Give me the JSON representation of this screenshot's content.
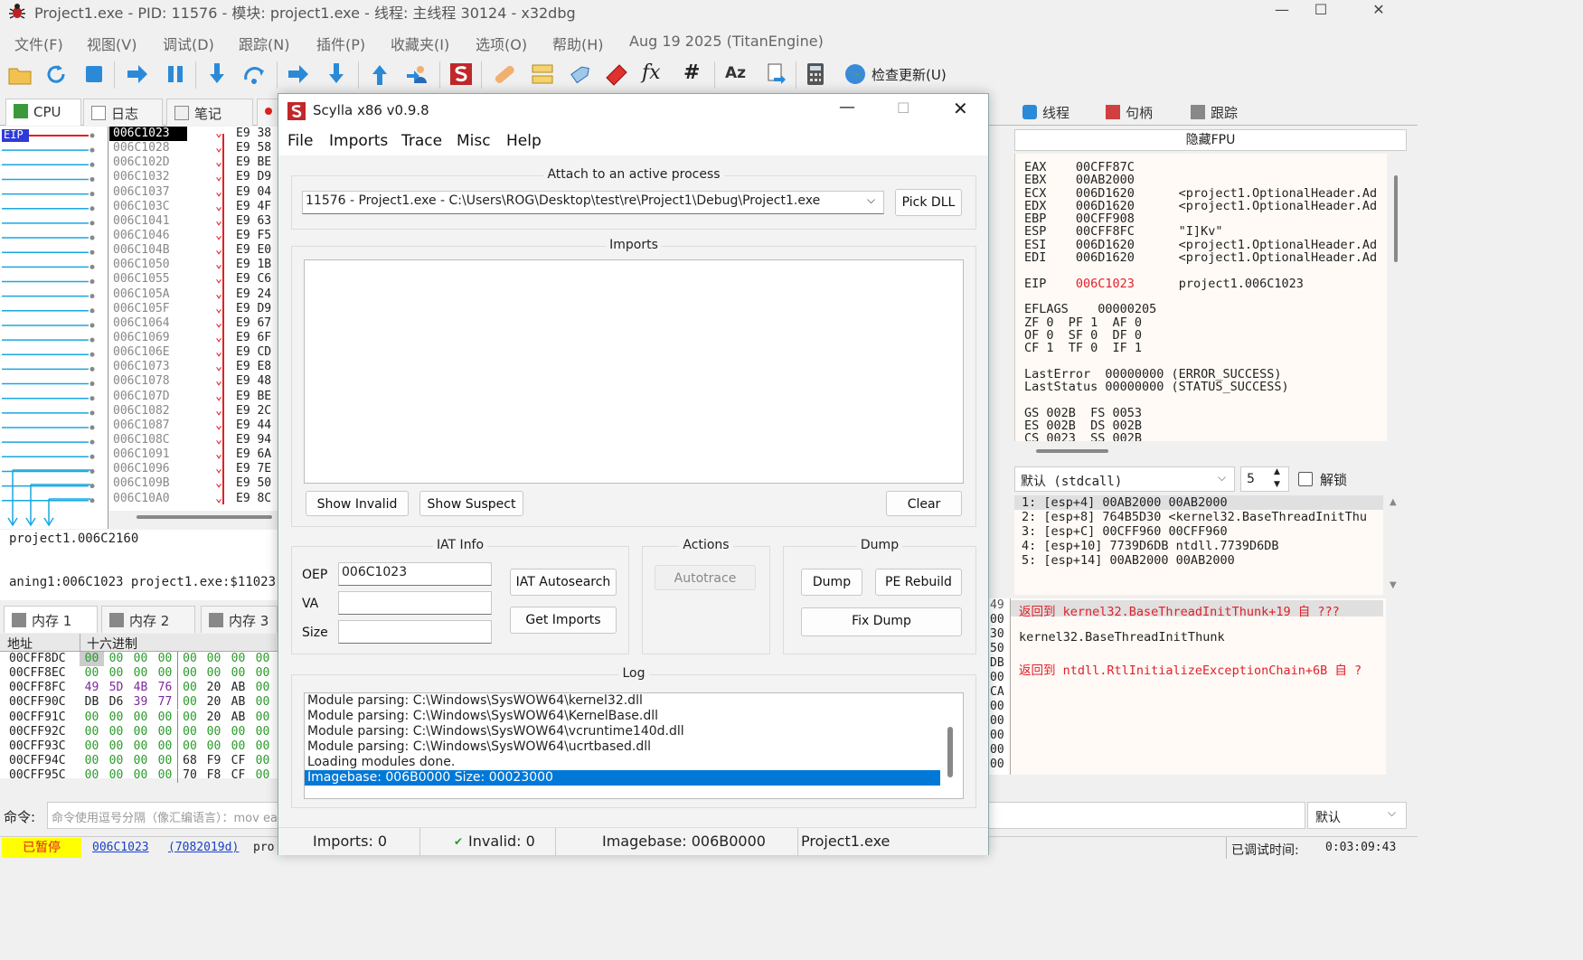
{
  "main_window": {
    "title": "Project1.exe - PID: 11576 - 模块: project1.exe - 线程: 主线程 30124 - x32dbg",
    "minimize": "—",
    "maximize": "☐",
    "close": "✕"
  },
  "menu": {
    "items": [
      "文件(F)",
      "视图(V)",
      "调试(D)",
      "跟踪(N)",
      "插件(P)",
      "收藏夹(I)",
      "选项(O)",
      "帮助(H)"
    ],
    "build_info": "Aug 19 2025 (TitanEngine)"
  },
  "toolbar": {
    "update_label": "检查更新(U)",
    "icons": [
      "open-icon",
      "restart-icon",
      "stop-icon",
      "run-icon",
      "pause-icon",
      "step-into-icon",
      "step-over-icon",
      "trace-into-icon",
      "trace-over-icon",
      "execute-till-return-icon",
      "run-to-user-code-icon",
      "scylla-icon",
      "patch-icon",
      "comments-icon",
      "labels-icon",
      "bookmarks-icon",
      "functions-icon",
      "hash-icon",
      "font-icon",
      "strings-icon",
      "calculator-icon",
      "update-icon"
    ],
    "formula_icon": "fx",
    "hash_icon": "#",
    "font_icon": "Az"
  },
  "tabs": {
    "cpu": "CPU",
    "log": "日志",
    "notes": "笔记",
    "threads": "线程",
    "handles": "句柄",
    "trace": "跟踪"
  },
  "disasm": {
    "eip_label": "EIP",
    "addresses": [
      "006C1023",
      "006C1028",
      "006C102D",
      "006C1032",
      "006C1037",
      "006C103C",
      "006C1041",
      "006C1046",
      "006C104B",
      "006C1050",
      "006C1055",
      "006C105A",
      "006C105F",
      "006C1064",
      "006C1069",
      "006C106E",
      "006C1073",
      "006C1078",
      "006C107D",
      "006C1082",
      "006C1087",
      "006C108C",
      "006C1091",
      "006C1096",
      "006C109B",
      "006C10A0"
    ],
    "bytes": [
      "E9 38",
      "E9 58",
      "E9 BE",
      "E9 D9",
      "E9 04",
      "E9 4F",
      "E9 63",
      "E9 F5",
      "E9 E0",
      "E9 1B",
      "E9 C6",
      "E9 24",
      "E9 D9",
      "E9 67",
      "E9 6F",
      "E9 CD",
      "E9 E8",
      "E9 48",
      "E9 BE",
      "E9 2C",
      "E9 44",
      "E9 94",
      "E9 6A",
      "E9 7E",
      "E9 50",
      "E9 8C"
    ]
  },
  "info_panel": {
    "line1": "project1.006C2160",
    "line2": "aning1:006C1023 project1.exe:$11023"
  },
  "memory": {
    "tabs": [
      "内存 1",
      "内存 2",
      "内存 3"
    ],
    "col_address": "地址",
    "col_hex": "十六进制",
    "rows": [
      {
        "addr": "00CFF8DC",
        "hex": "00 00 00 00 00 00 00 00"
      },
      {
        "addr": "00CFF8EC",
        "hex": "00 00 00 00 00 00 00 00"
      },
      {
        "addr": "00CFF8FC",
        "hex": "49 5D 4B 76 00 20 AB 00"
      },
      {
        "addr": "00CFF90C",
        "hex": "DB D6 39 77 00 20 AB 00"
      },
      {
        "addr": "00CFF91C",
        "hex": "00 00 00 00 00 20 AB 00"
      },
      {
        "addr": "00CFF92C",
        "hex": "00 00 00 00 00 00 00 00"
      },
      {
        "addr": "00CFF93C",
        "hex": "00 00 00 00 00 00 00 00"
      },
      {
        "addr": "00CFF94C",
        "hex": "00 00 00 00 68 F9 CF 00"
      },
      {
        "addr": "00CFF95C",
        "hex": "00 00 00 00 70 F8 CF 00"
      }
    ]
  },
  "command": {
    "label": "命令:",
    "placeholder": "命令使用逗号分隔（像汇编语言）：mov eax, ebx",
    "mode": "默认"
  },
  "status": {
    "state": "已暂停",
    "addr_link": "006C1023",
    "rva_link": "(7082019d)",
    "trail": "pro",
    "elapsed_label": "已调试时间:",
    "elapsed": "0:03:09:43"
  },
  "fpu_header": "隐藏FPU",
  "registers": [
    "EAX    00CFF87C",
    "EBX    00AB2000",
    "ECX    006D1620      <project1.OptionalHeader.Ad",
    "EDX    006D1620      <project1.OptionalHeader.Ad",
    "EBP    00CFF908",
    "ESP    00CFF8FC      \"I]Kv\"",
    "ESI    006D1620      <project1.OptionalHeader.Ad",
    "EDI    006D1620      <project1.OptionalHeader.Ad",
    "",
    "EIP    006C1023      project1.006C1023",
    "",
    "EFLAGS    00000205",
    "ZF 0  PF 1  AF 0",
    "OF 0  SF 0  DF 0",
    "CF 1  TF 0  IF 1",
    "",
    "LastError  00000000 (ERROR_SUCCESS)",
    "LastStatus 00000000 (STATUS_SUCCESS)",
    "",
    "GS 002B  FS 0053",
    "ES 002B  DS 002B",
    "CS 0023  SS 002B"
  ],
  "callconv": {
    "value": "默认 (stdcall)",
    "count": "5",
    "unlock_label": "解锁"
  },
  "stack_args": [
    "1: [esp+4] 00AB2000 00AB2000",
    "2: [esp+8] 764B5D30 <kernel32.BaseThreadInitThu",
    "3: [esp+C] 00CFF960 00CFF960",
    "4: [esp+10] 7739D6DB ntdll.7739D6DB",
    "5: [esp+14] 00AB2000 00AB2000"
  ],
  "stack_view": {
    "left_col": [
      "49",
      "00",
      "30",
      "50",
      "DB",
      "00",
      "CA",
      "00",
      "00",
      "00",
      "00",
      "00"
    ],
    "line1": "返回到 kernel32.BaseThreadInitThunk+19 自 ???",
    "line2": "kernel32.BaseThreadInitThunk",
    "line3": "返回到 ntdll.RtlInitializeExceptionChain+6B 自 ?"
  },
  "scylla": {
    "title": "Scylla x86 v0.9.8",
    "menu": [
      "File",
      "Imports",
      "Trace",
      "Misc",
      "Help"
    ],
    "attach_caption": "Attach to an active process",
    "process": "11576 - Project1.exe - C:\\Users\\ROG\\Desktop\\test\\re\\Project1\\Debug\\Project1.exe",
    "pick_dll": "Pick DLL",
    "imports_caption": "Imports",
    "show_invalid": "Show Invalid",
    "show_suspect": "Show Suspect",
    "clear": "Clear",
    "iat_caption": "IAT Info",
    "oep_label": "OEP",
    "oep_value": "006C1023",
    "va_label": "VA",
    "size_label": "Size",
    "iat_autosearch": "IAT Autosearch",
    "get_imports": "Get Imports",
    "actions_caption": "Actions",
    "autotrace": "Autotrace",
    "dump_caption": "Dump",
    "dump": "Dump",
    "pe_rebuild": "PE Rebuild",
    "fix_dump": "Fix Dump",
    "log_caption": "Log",
    "log": [
      "Module parsing: C:\\Windows\\SysWOW64\\kernel32.dll",
      "Module parsing: C:\\Windows\\SysWOW64\\KernelBase.dll",
      "Module parsing: C:\\Windows\\SysWOW64\\vcruntime140d.dll",
      "Module parsing: C:\\Windows\\SysWOW64\\ucrtbased.dll",
      "Loading modules done.",
      "Imagebase: 006B0000 Size: 00023000"
    ],
    "status_imports": "Imports: 0",
    "status_invalid": "Invalid: 0",
    "status_imagebase": "Imagebase: 006B0000",
    "status_module": "Project1.exe"
  },
  "colors": {
    "accent_blue": "#0078d7",
    "eip_bg": "#2f3bd8",
    "jump_line": "#19a7e0",
    "red_arrow": "#e0202a",
    "reg_changed": "#e0202a",
    "reg_bg": "#fffaf5",
    "paused_bg": "#ffff00",
    "paused_fg": "#e02020",
    "scylla_logo": "#c0282a"
  }
}
